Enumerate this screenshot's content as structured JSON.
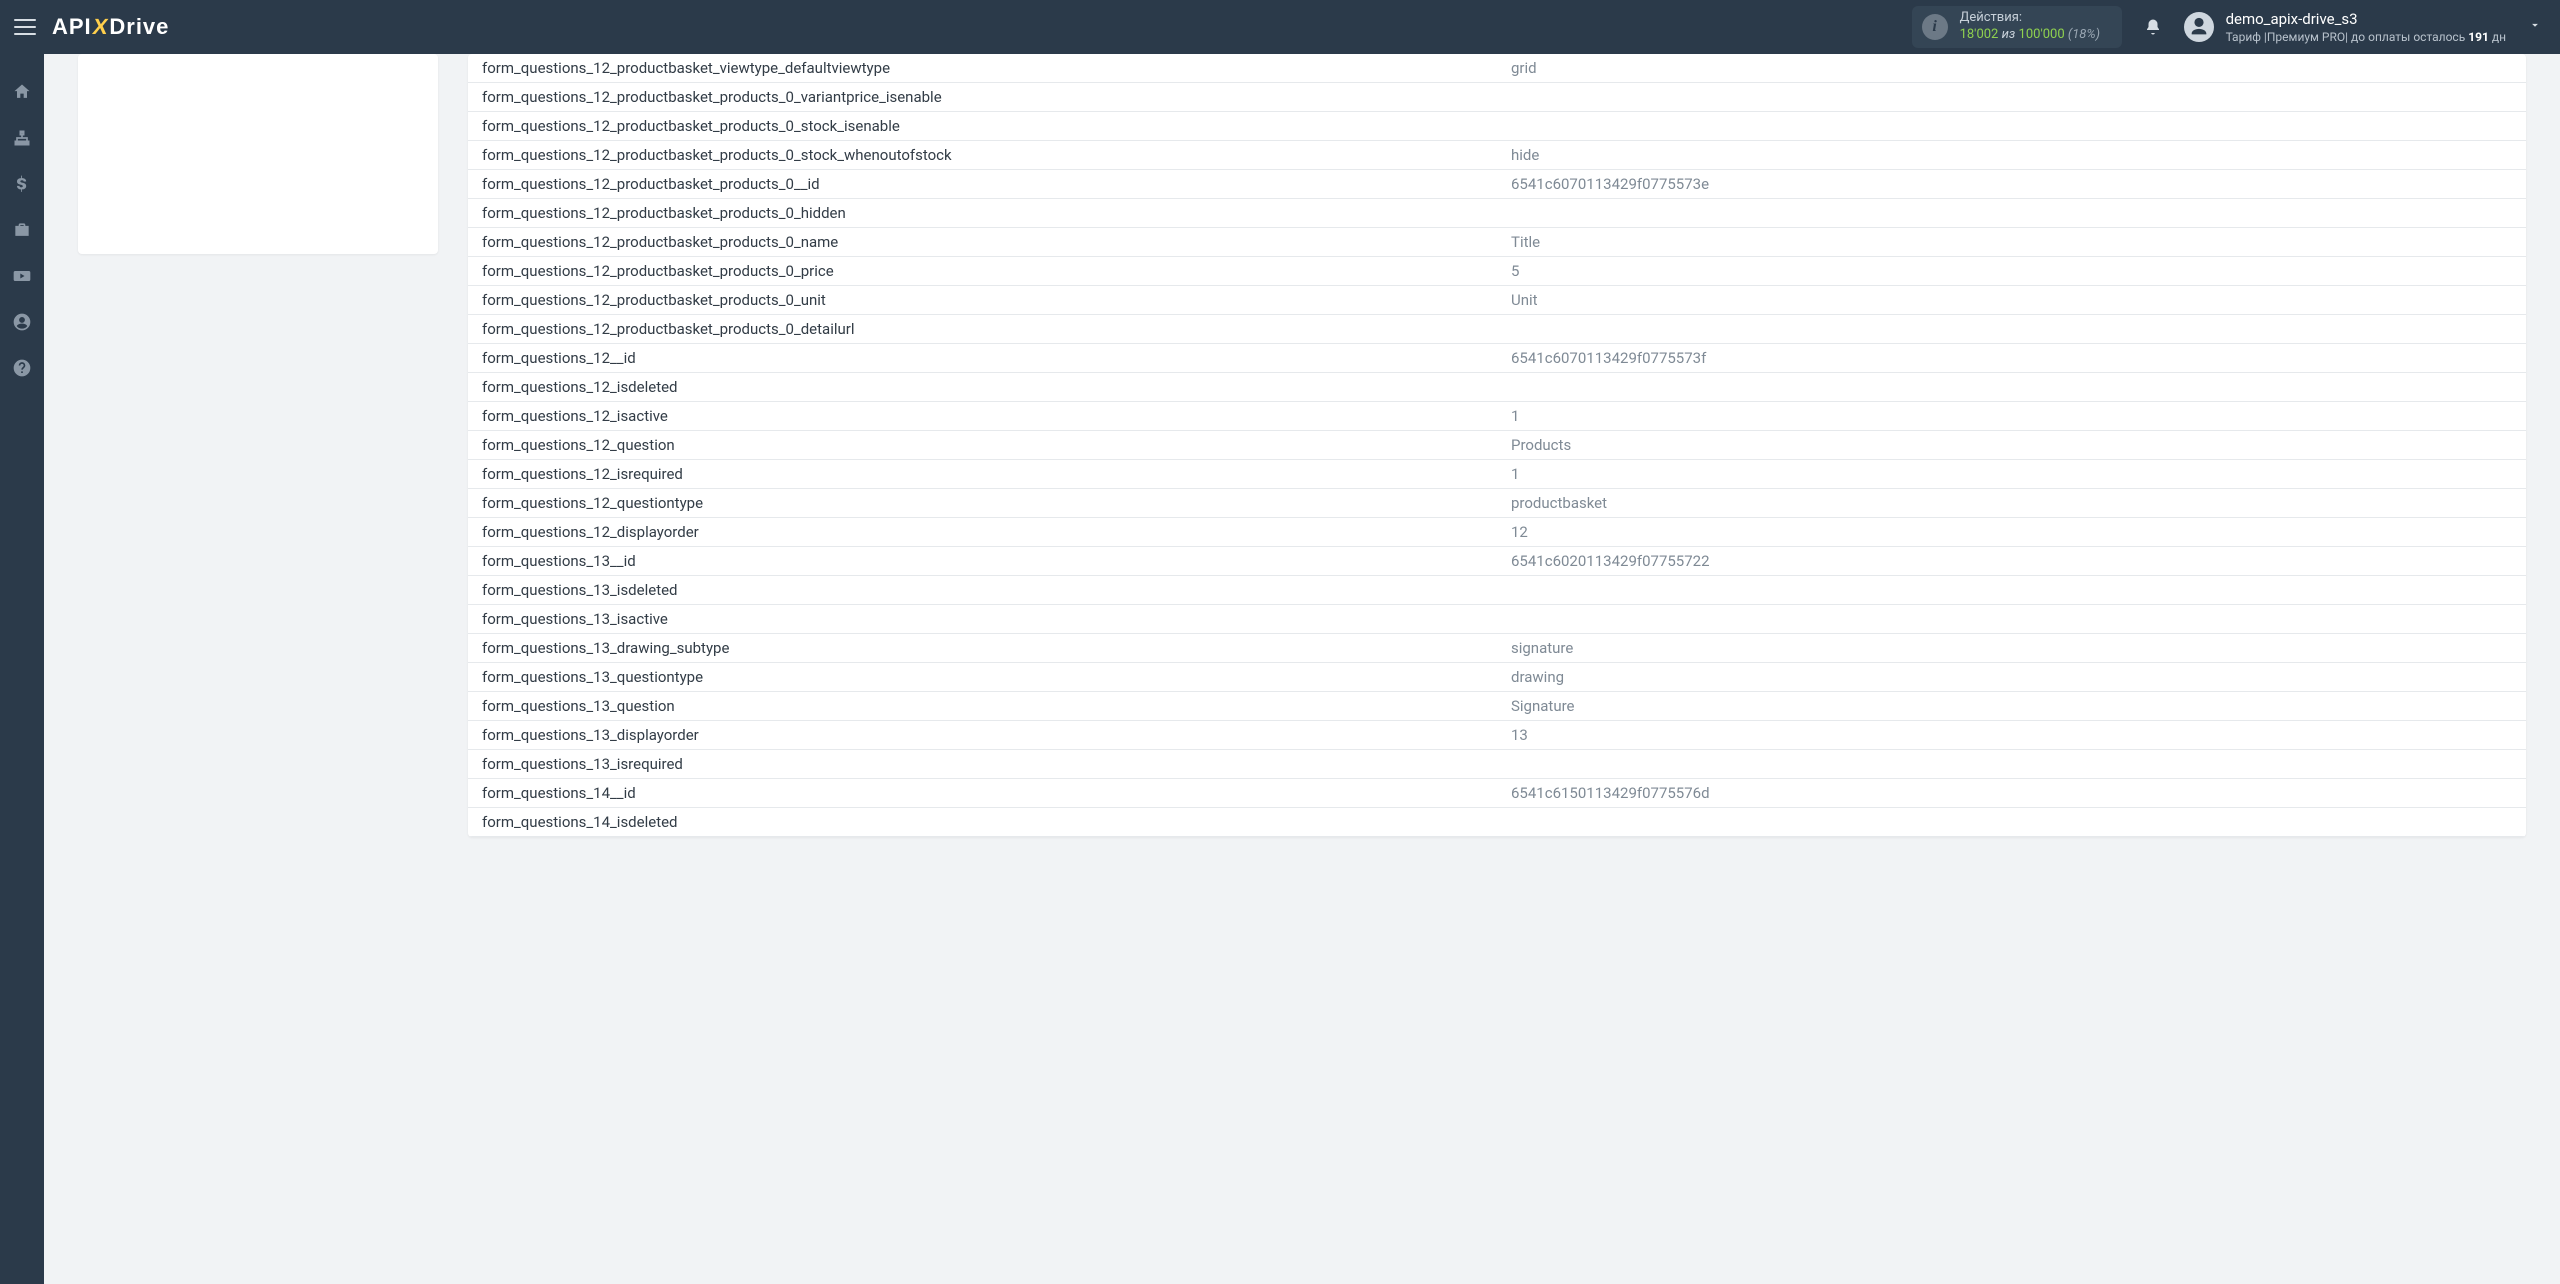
{
  "brand": {
    "pre": "API",
    "x": "X",
    "post": "Drive"
  },
  "actions": {
    "label": "Действия:",
    "used": "18'002",
    "of": "из",
    "total": "100'000",
    "pct": "(18%)"
  },
  "user": {
    "name": "demo_apix-drive_s3",
    "plan_prefix": "Тариф |",
    "plan_name": "Премиум PRO",
    "days_prefix": "|  до оплаты осталось ",
    "days_num": "191",
    "days_suffix": " дн"
  },
  "rows": [
    {
      "k": "form_questions_12_productbasket_viewtype_defaultviewtype",
      "v": "grid"
    },
    {
      "k": "form_questions_12_productbasket_products_0_variantprice_isenable",
      "v": ""
    },
    {
      "k": "form_questions_12_productbasket_products_0_stock_isenable",
      "v": ""
    },
    {
      "k": "form_questions_12_productbasket_products_0_stock_whenoutofstock",
      "v": "hide"
    },
    {
      "k": "form_questions_12_productbasket_products_0__id",
      "v": "6541c6070113429f0775573e"
    },
    {
      "k": "form_questions_12_productbasket_products_0_hidden",
      "v": ""
    },
    {
      "k": "form_questions_12_productbasket_products_0_name",
      "v": "Title"
    },
    {
      "k": "form_questions_12_productbasket_products_0_price",
      "v": "5"
    },
    {
      "k": "form_questions_12_productbasket_products_0_unit",
      "v": "Unit"
    },
    {
      "k": "form_questions_12_productbasket_products_0_detailurl",
      "v": ""
    },
    {
      "k": "form_questions_12__id",
      "v": "6541c6070113429f0775573f"
    },
    {
      "k": "form_questions_12_isdeleted",
      "v": ""
    },
    {
      "k": "form_questions_12_isactive",
      "v": "1"
    },
    {
      "k": "form_questions_12_question",
      "v": "Products"
    },
    {
      "k": "form_questions_12_isrequired",
      "v": "1"
    },
    {
      "k": "form_questions_12_questiontype",
      "v": "productbasket"
    },
    {
      "k": "form_questions_12_displayorder",
      "v": "12"
    },
    {
      "k": "form_questions_13__id",
      "v": "6541c6020113429f07755722"
    },
    {
      "k": "form_questions_13_isdeleted",
      "v": ""
    },
    {
      "k": "form_questions_13_isactive",
      "v": ""
    },
    {
      "k": "form_questions_13_drawing_subtype",
      "v": "signature"
    },
    {
      "k": "form_questions_13_questiontype",
      "v": "drawing"
    },
    {
      "k": "form_questions_13_question",
      "v": "Signature"
    },
    {
      "k": "form_questions_13_displayorder",
      "v": "13"
    },
    {
      "k": "form_questions_13_isrequired",
      "v": ""
    },
    {
      "k": "form_questions_14__id",
      "v": "6541c6150113429f0775576d"
    },
    {
      "k": "form_questions_14_isdeleted",
      "v": ""
    }
  ]
}
